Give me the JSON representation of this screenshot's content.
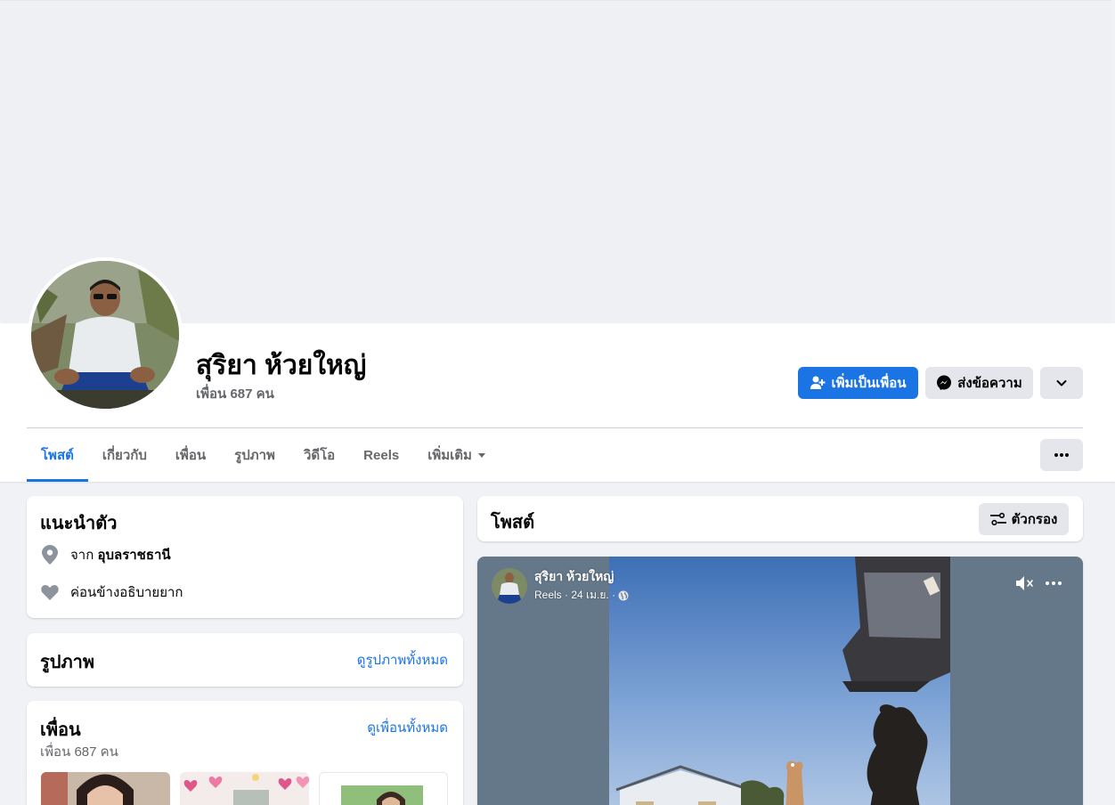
{
  "profile": {
    "name": "สุริยา ห้วยใหญ่",
    "friends_count": "เพื่อน 687 คน"
  },
  "actions": {
    "add_friend": "เพิ่มเป็นเพื่อน",
    "message": "ส่งข้อความ"
  },
  "tabs": [
    {
      "label": "โพสต์",
      "active": true
    },
    {
      "label": "เกี่ยวกับ"
    },
    {
      "label": "เพื่อน"
    },
    {
      "label": "รูปภาพ"
    },
    {
      "label": "วิดีโอ"
    },
    {
      "label": "Reels"
    },
    {
      "label": "เพิ่มเติม"
    }
  ],
  "intro": {
    "title": "แนะนำตัว",
    "from_prefix": "จาก",
    "from_place": "อุบลราชธานี",
    "relationship": "ค่อนข้างอธิบายยาก"
  },
  "photos": {
    "title": "รูปภาพ",
    "see_all": "ดูรูปภาพทั้งหมด"
  },
  "friends": {
    "title": "เพื่อน",
    "count": "เพื่อน 687 คน",
    "see_all": "ดูเพื่อนทั้งหมด"
  },
  "posts": {
    "title": "โพสต์",
    "filter_label": "ตัวกรอง"
  },
  "reel_post": {
    "author": "สุริยา ห้วยใหญ่",
    "meta": "Reels · 24 เม.ย. ·"
  },
  "colors": {
    "accent": "#1b74e4",
    "page_bg": "#f0f2f5",
    "secondary_button": "#e4e6eb",
    "muted_text": "#65676b"
  },
  "icons": [
    "add-friend-icon",
    "messenger-icon",
    "chevron-down-icon",
    "more-icon",
    "location-pin-icon",
    "heart-icon",
    "filter-icon",
    "globe-icon",
    "mute-icon"
  ]
}
